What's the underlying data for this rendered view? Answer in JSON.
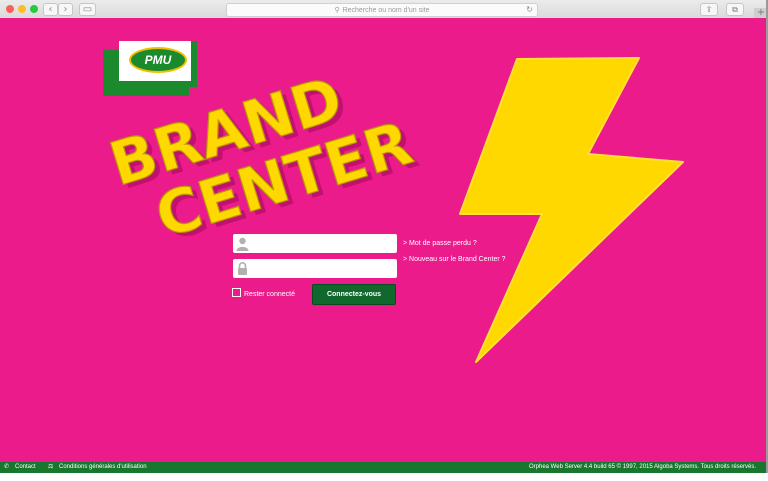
{
  "browser": {
    "back_glyph": "‹",
    "forward_glyph": "›",
    "sidebar_glyph": "▭",
    "search_glyph": "⚲",
    "address_placeholder": "Recherche ou nom d'un site",
    "reload_glyph": "↻",
    "share_glyph": "⇪",
    "tabs_glyph": "⧉",
    "new_tab_glyph": "+"
  },
  "logo": {
    "text": "PMU"
  },
  "brand": {
    "line1": "BRAND",
    "line2": "CENTER"
  },
  "login": {
    "username_value": "",
    "password_value": "",
    "forgot_password": "> Mot de passe perdu ?",
    "new_user": "> Nouveau sur le Brand Center ?",
    "remember_label": "Rester connecté",
    "submit_label": "Connectez-vous"
  },
  "footer": {
    "contact": "Contact",
    "terms": "Conditions générales d'utilisation",
    "copyright": "Orphea Web Server 4.4 build 65 © 1997, 2015 Algoba Systems. Tous droits réservés."
  },
  "colors": {
    "background": "#ec1b8c",
    "bolt": "#ffd800",
    "brand_green": "#1a8a2c",
    "button_green": "#10682d",
    "footer_green": "#17772e"
  },
  "icons": [
    "user-icon",
    "lock-icon",
    "contact-icon",
    "terms-icon",
    "lightning-bolt-icon"
  ]
}
